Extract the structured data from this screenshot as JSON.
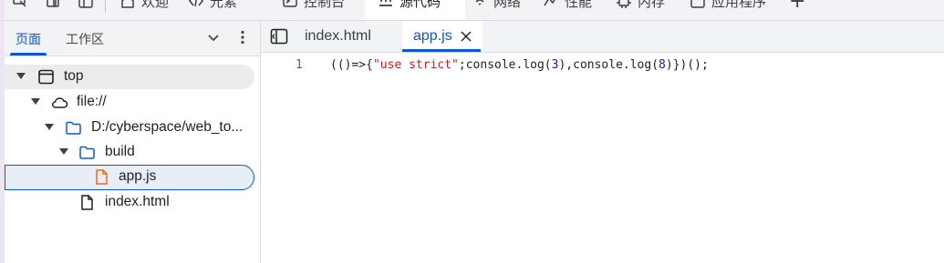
{
  "toolbar": {
    "items": [
      {
        "label": "欢迎",
        "icon": "welcome-icon"
      },
      {
        "label": "元素",
        "icon": "elements-icon"
      },
      {
        "label": "控制台",
        "icon": "console-icon"
      },
      {
        "label": "源代码",
        "icon": "sources-icon",
        "active": true
      },
      {
        "label": "网络",
        "icon": "wifi-icon"
      },
      {
        "label": "性能",
        "icon": "performance-icon"
      },
      {
        "label": "内存",
        "icon": "memory-icon"
      },
      {
        "label": "应用程序",
        "icon": "application-icon"
      }
    ],
    "add_label": "+"
  },
  "sidebar": {
    "tabs": [
      "页面",
      "工作区"
    ],
    "active_tab": "页面",
    "tree": [
      {
        "label": "top",
        "icon": "window-icon"
      },
      {
        "label": "file://",
        "icon": "cloud-icon"
      },
      {
        "label": "D:/cyberspace/web_to...",
        "icon": "folder-icon"
      },
      {
        "label": "build",
        "icon": "folder-icon"
      },
      {
        "label": "app.js",
        "icon": "js-file-icon",
        "selected": true
      },
      {
        "label": "index.html",
        "icon": "file-icon"
      }
    ]
  },
  "editor": {
    "tabs": [
      {
        "label": "index.html"
      },
      {
        "label": "app.js",
        "active": true
      }
    ],
    "line_number": "1",
    "code": {
      "p1": "(()=>{",
      "s1": "\"use strict\"",
      "p2": ";console.log(",
      "n1": "3",
      "p3": "),console.log(",
      "n2": "8",
      "p4": ")})();"
    }
  },
  "colors": {
    "accent": "#0b57d0",
    "toolbar_bg": "#f1f3f4",
    "selected_bg": "#e8eef7",
    "string": "#c5221f",
    "number": "#1a1aa6",
    "js_file": "#e8710a"
  }
}
